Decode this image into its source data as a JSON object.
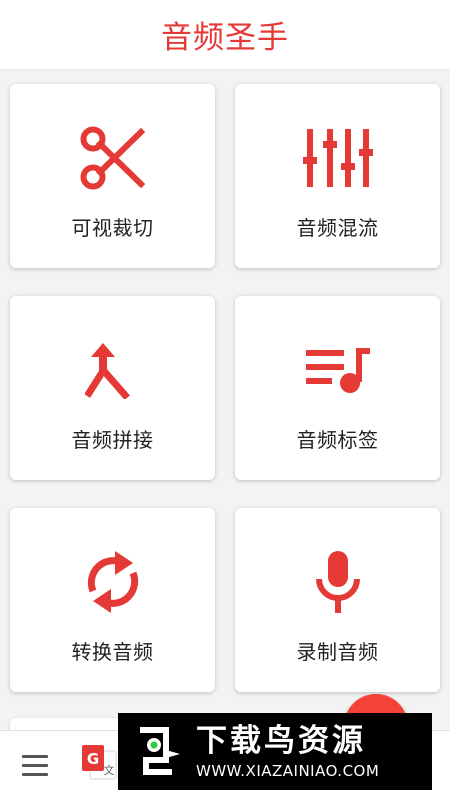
{
  "app": {
    "title": "音频圣手",
    "accent_color": "#e53935"
  },
  "tools": [
    {
      "label": "可视裁切",
      "icon": "scissors-icon"
    },
    {
      "label": "音频混流",
      "icon": "equalizer-sliders-icon"
    },
    {
      "label": "音频拼接",
      "icon": "merge-arrow-icon"
    },
    {
      "label": "音频标签",
      "icon": "playlist-music-note-icon"
    },
    {
      "label": "转换音频",
      "icon": "sync-arrows-icon"
    },
    {
      "label": "录制音频",
      "icon": "microphone-icon"
    }
  ],
  "bottom_bar": {
    "menu_icon": "hamburger-menu-icon",
    "translate_icon": "google-translate-icon"
  },
  "watermark": {
    "brand": "下载鸟资源",
    "url": "WWW.XIAZAINIAO.COM"
  }
}
